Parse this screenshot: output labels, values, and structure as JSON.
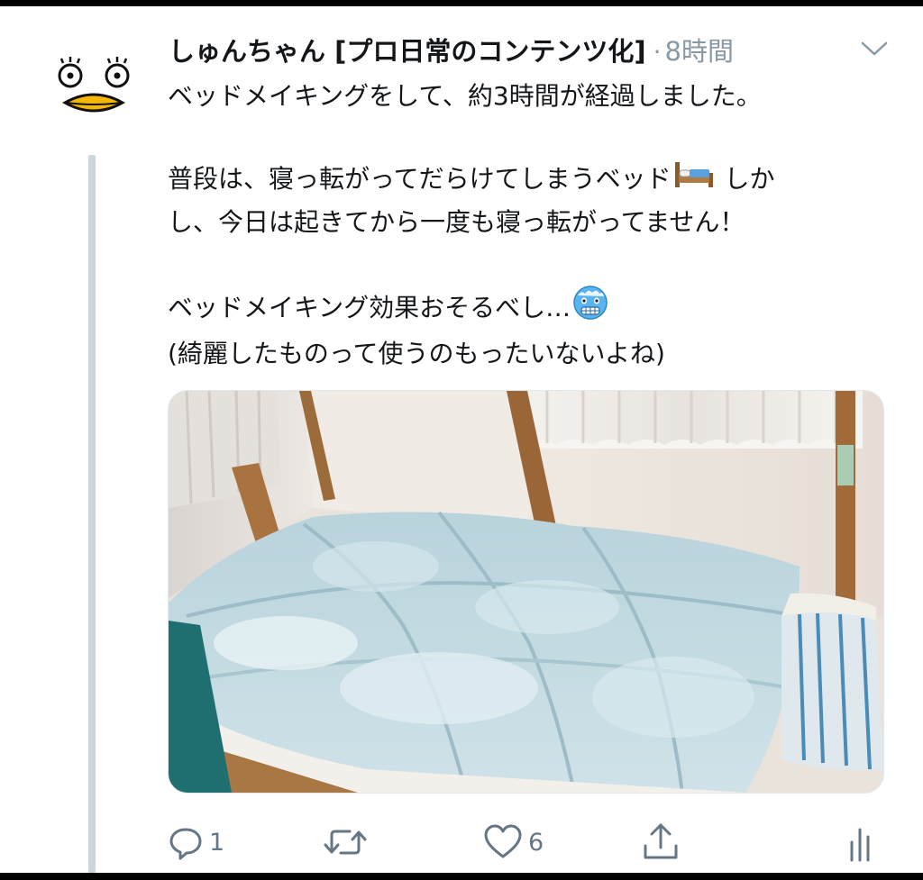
{
  "tweet": {
    "author": {
      "display_name": "しゅんちゃん [プロ日常のコンテンツ化]",
      "avatar_icon": "duck-face-avatar-icon"
    },
    "separator": "·",
    "timestamp": "8時間",
    "text_lines": [
      "ベッドメイキングをして、約3時間が経過しました。",
      "",
      "普段は、寝っ転がってだらけてしまうベッド",
      "し、今日は起きてから一度も寝っ転がってません！",
      "",
      "ベッドメイキング効果おそるべし…",
      "(綺麗したものって使うのもったいないよね)"
    ],
    "line3_tail": " しか",
    "emojis": [
      "bed-emoji",
      "freezing-face-emoji"
    ],
    "media": {
      "description_icon": "bed-photo"
    },
    "actions": {
      "reply_count": "1",
      "retweet_count": "",
      "like_count": "6"
    }
  },
  "colors": {
    "icon_gray": "#657786",
    "secondary_text": "#8899a6",
    "thread_line": "#ccd6dd",
    "duck_beak": "#f5b800"
  }
}
